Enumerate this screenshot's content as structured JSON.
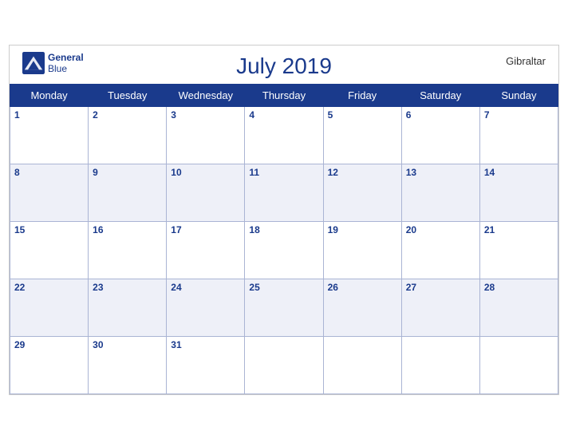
{
  "header": {
    "title": "July 2019",
    "country": "Gibraltar",
    "logo_line1": "General",
    "logo_line2": "Blue"
  },
  "weekdays": [
    "Monday",
    "Tuesday",
    "Wednesday",
    "Thursday",
    "Friday",
    "Saturday",
    "Sunday"
  ],
  "weeks": [
    [
      {
        "date": "1",
        "empty": false
      },
      {
        "date": "2",
        "empty": false
      },
      {
        "date": "3",
        "empty": false
      },
      {
        "date": "4",
        "empty": false
      },
      {
        "date": "5",
        "empty": false
      },
      {
        "date": "6",
        "empty": false
      },
      {
        "date": "7",
        "empty": false
      }
    ],
    [
      {
        "date": "8",
        "empty": false
      },
      {
        "date": "9",
        "empty": false
      },
      {
        "date": "10",
        "empty": false
      },
      {
        "date": "11",
        "empty": false
      },
      {
        "date": "12",
        "empty": false
      },
      {
        "date": "13",
        "empty": false
      },
      {
        "date": "14",
        "empty": false
      }
    ],
    [
      {
        "date": "15",
        "empty": false
      },
      {
        "date": "16",
        "empty": false
      },
      {
        "date": "17",
        "empty": false
      },
      {
        "date": "18",
        "empty": false
      },
      {
        "date": "19",
        "empty": false
      },
      {
        "date": "20",
        "empty": false
      },
      {
        "date": "21",
        "empty": false
      }
    ],
    [
      {
        "date": "22",
        "empty": false
      },
      {
        "date": "23",
        "empty": false
      },
      {
        "date": "24",
        "empty": false
      },
      {
        "date": "25",
        "empty": false
      },
      {
        "date": "26",
        "empty": false
      },
      {
        "date": "27",
        "empty": false
      },
      {
        "date": "28",
        "empty": false
      }
    ],
    [
      {
        "date": "29",
        "empty": false
      },
      {
        "date": "30",
        "empty": false
      },
      {
        "date": "31",
        "empty": false
      },
      {
        "date": "",
        "empty": true
      },
      {
        "date": "",
        "empty": true
      },
      {
        "date": "",
        "empty": true
      },
      {
        "date": "",
        "empty": true
      }
    ]
  ],
  "colors": {
    "header_bg": "#1a3a8c",
    "row_bg_even": "#eef0f8",
    "row_bg_odd": "#ffffff",
    "date_color": "#1a3a8c",
    "brand_blue": "#1a3a8c"
  }
}
